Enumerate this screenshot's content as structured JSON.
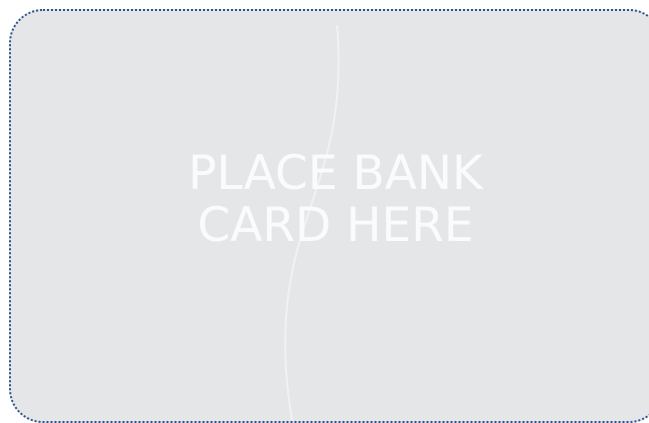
{
  "card_slot": {
    "line1": "PLACE BANK",
    "line2": "CARD HERE"
  },
  "colors": {
    "background": "#e5e6e8",
    "border": "#2d4f8e",
    "text": "#fbfbfc",
    "curve": "#f0f1f2"
  }
}
